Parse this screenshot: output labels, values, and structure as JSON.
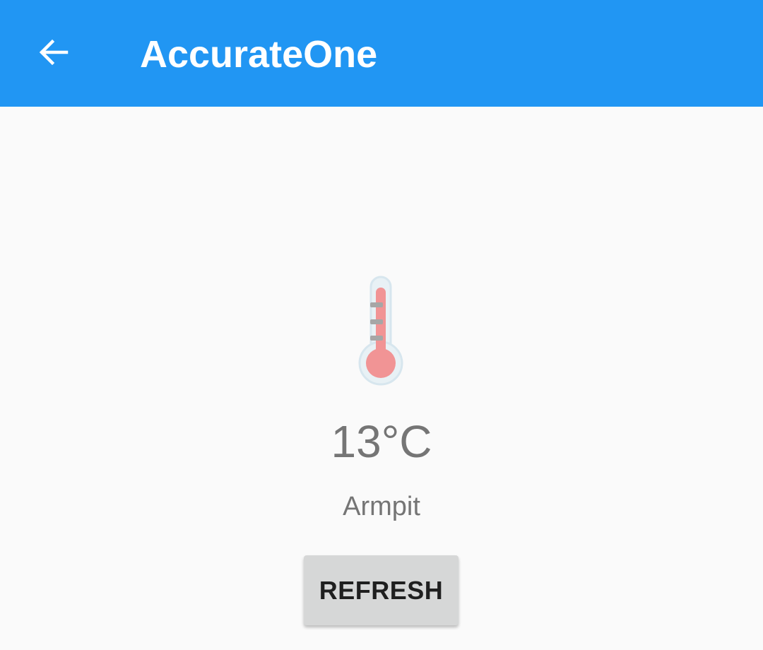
{
  "app_bar": {
    "title": "AccurateOne",
    "back_icon": "arrow-back-icon",
    "color": "#2196f3"
  },
  "reading": {
    "temperature": "13°C",
    "location": "Armpit",
    "icon": "thermometer-icon"
  },
  "actions": {
    "refresh_label": "REFRESH"
  }
}
